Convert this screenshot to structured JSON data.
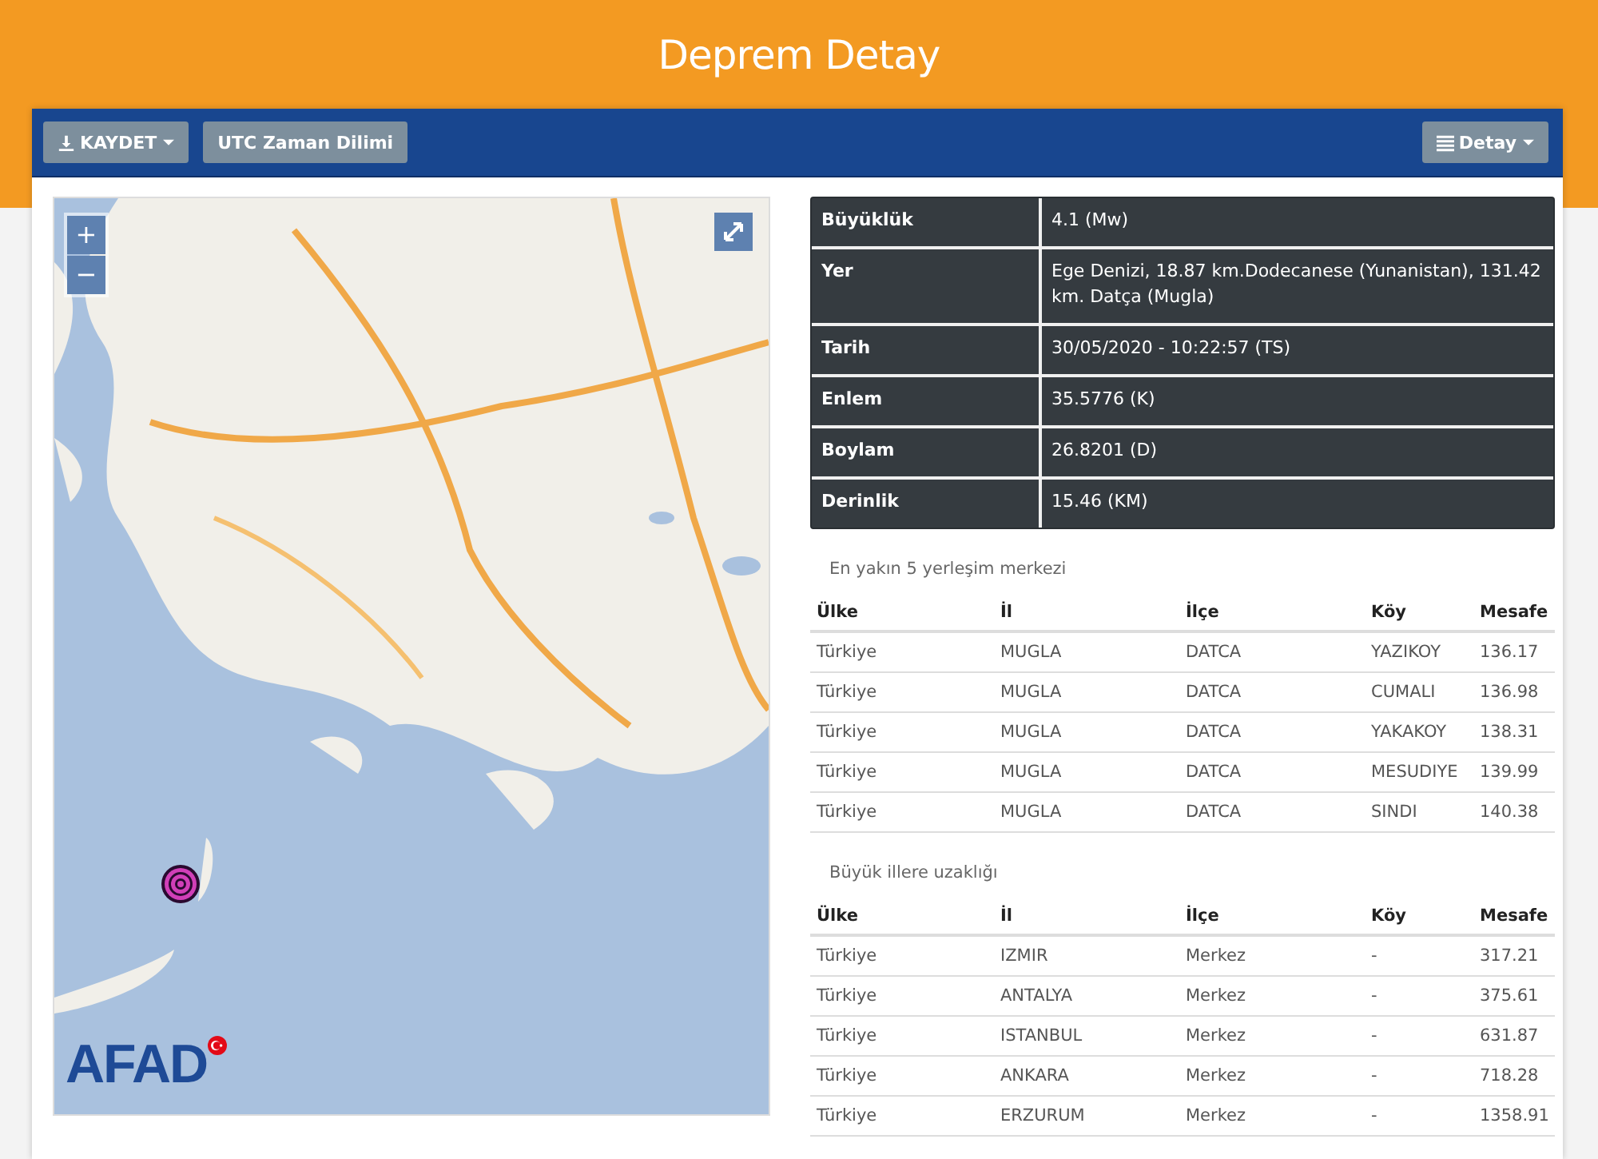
{
  "header": {
    "title": "Deprem Detay"
  },
  "toolbar": {
    "left_buttons": [
      {
        "label": "KAYDET",
        "kind": "download"
      },
      {
        "label": "UTC Zaman Dilimi",
        "kind": "plain"
      }
    ],
    "right_button": {
      "label": "Detay",
      "kind": "list"
    }
  },
  "map": {
    "kind": "picture",
    "zoom_in": "+",
    "zoom_out": "−",
    "logo": "AFAD"
  },
  "details": [
    {
      "label": "Büyüklük",
      "value": "4.1 (Mw)"
    },
    {
      "label": "Yer",
      "value": "Ege Denizi, 18.87 km.Dodecanese (Yunanistan), 131.42 km. Datça (Mugla)"
    },
    {
      "label": "Tarih",
      "value": "30/05/2020 - 10:22:57 (TS)"
    },
    {
      "label": "Enlem",
      "value": "35.5776 (K)"
    },
    {
      "label": "Boylam",
      "value": "26.8201 (D)"
    },
    {
      "label": "Derinlik",
      "value": "15.46 (KM)"
    }
  ],
  "tables": [
    {
      "caption": "En yakın 5 yerleşim merkezi",
      "columns": [
        "Ülke",
        "İl",
        "İlçe",
        "Köy",
        "Mesafe"
      ],
      "rows": [
        [
          "Türkiye",
          "MUGLA",
          "DATCA",
          "YAZIKOY",
          "136.17"
        ],
        [
          "Türkiye",
          "MUGLA",
          "DATCA",
          "CUMALI",
          "136.98"
        ],
        [
          "Türkiye",
          "MUGLA",
          "DATCA",
          "YAKAKOY",
          "138.31"
        ],
        [
          "Türkiye",
          "MUGLA",
          "DATCA",
          "MESUDIYE",
          "139.99"
        ],
        [
          "Türkiye",
          "MUGLA",
          "DATCA",
          "SINDI",
          "140.38"
        ]
      ]
    },
    {
      "caption": "Büyük illere uzaklığı",
      "columns": [
        "Ülke",
        "İl",
        "İlçe",
        "Köy",
        "Mesafe"
      ],
      "rows": [
        [
          "Türkiye",
          "IZMIR",
          "Merkez",
          "-",
          "317.21"
        ],
        [
          "Türkiye",
          "ANTALYA",
          "Merkez",
          "-",
          "375.61"
        ],
        [
          "Türkiye",
          "ISTANBUL",
          "Merkez",
          "-",
          "631.87"
        ],
        [
          "Türkiye",
          "ANKARA",
          "Merkez",
          "-",
          "718.28"
        ],
        [
          "Türkiye",
          "ERZURUM",
          "Merkez",
          "-",
          "1358.91"
        ]
      ]
    }
  ]
}
